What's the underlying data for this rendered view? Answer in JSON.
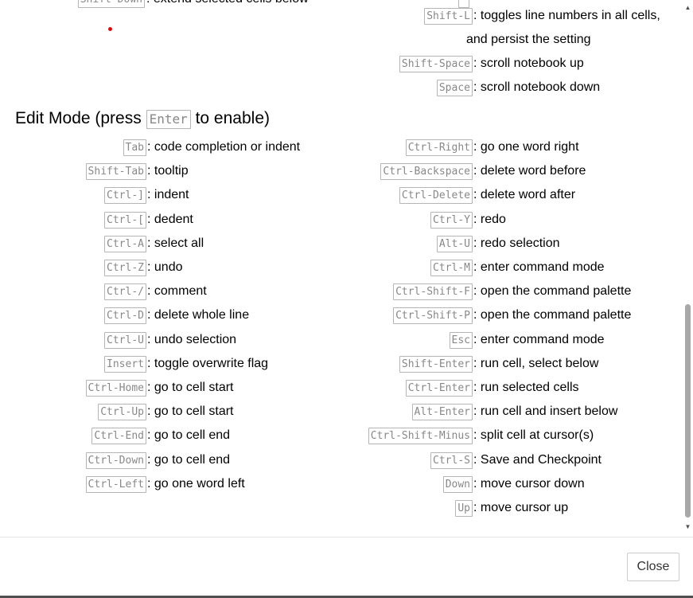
{
  "top_partial": {
    "left_kbd": "Shift-Down",
    "left_desc": ": extend selected cells below"
  },
  "command_tail": [
    {
      "key": "Shift-L",
      "desc": ": toggles line numbers in all cells,"
    },
    {
      "key": "",
      "desc": "and persist the setting"
    },
    {
      "key": "Shift-Space",
      "desc": ": scroll notebook up"
    },
    {
      "key": "Space",
      "desc": ": scroll notebook down"
    }
  ],
  "edit_mode": {
    "title_before": "Edit Mode (press ",
    "title_key": "Enter",
    "title_after": " to enable)",
    "left": [
      {
        "key": "Tab",
        "desc": ": code completion or indent"
      },
      {
        "key": "Shift-Tab",
        "desc": ": tooltip"
      },
      {
        "key": "Ctrl-]",
        "desc": ": indent"
      },
      {
        "key": "Ctrl-[",
        "desc": ": dedent"
      },
      {
        "key": "Ctrl-A",
        "desc": ": select all"
      },
      {
        "key": "Ctrl-Z",
        "desc": ": undo"
      },
      {
        "key": "Ctrl-/",
        "desc": ": comment"
      },
      {
        "key": "Ctrl-D",
        "desc": ": delete whole line"
      },
      {
        "key": "Ctrl-U",
        "desc": ": undo selection"
      },
      {
        "key": "Insert",
        "desc": ": toggle overwrite flag"
      },
      {
        "key": "Ctrl-Home",
        "desc": ": go to cell start"
      },
      {
        "key": "Ctrl-Up",
        "desc": ": go to cell start"
      },
      {
        "key": "Ctrl-End",
        "desc": ": go to cell end"
      },
      {
        "key": "Ctrl-Down",
        "desc": ": go to cell end"
      },
      {
        "key": "Ctrl-Left",
        "desc": ": go one word left"
      }
    ],
    "right": [
      {
        "key": "Ctrl-Right",
        "desc": ": go one word right"
      },
      {
        "key": "Ctrl-Backspace",
        "desc": ": delete word before"
      },
      {
        "key": "Ctrl-Delete",
        "desc": ": delete word after"
      },
      {
        "key": "Ctrl-Y",
        "desc": ": redo"
      },
      {
        "key": "Alt-U",
        "desc": ": redo selection"
      },
      {
        "key": "Ctrl-M",
        "desc": ": enter command mode"
      },
      {
        "key": "Ctrl-Shift-F",
        "desc": ": open the command palette"
      },
      {
        "key": "Ctrl-Shift-P",
        "desc": ": open the command palette"
      },
      {
        "key": "Esc",
        "desc": ": enter command mode"
      },
      {
        "key": "Shift-Enter",
        "desc": ": run cell, select below"
      },
      {
        "key": "Ctrl-Enter",
        "desc": ": run selected cells"
      },
      {
        "key": "Alt-Enter",
        "desc": ": run cell and insert below"
      },
      {
        "key": "Ctrl-Shift-Minus",
        "desc": ": split cell at cursor(s)"
      },
      {
        "key": "Ctrl-S",
        "desc": ": Save and Checkpoint"
      },
      {
        "key": "Down",
        "desc": ": move cursor down"
      },
      {
        "key": "Up",
        "desc": ": move cursor up"
      }
    ]
  },
  "footer": {
    "close_label": "Close"
  },
  "scrollbar": {
    "up_icon": "triangle-up-icon",
    "down_icon": "triangle-down-icon"
  }
}
